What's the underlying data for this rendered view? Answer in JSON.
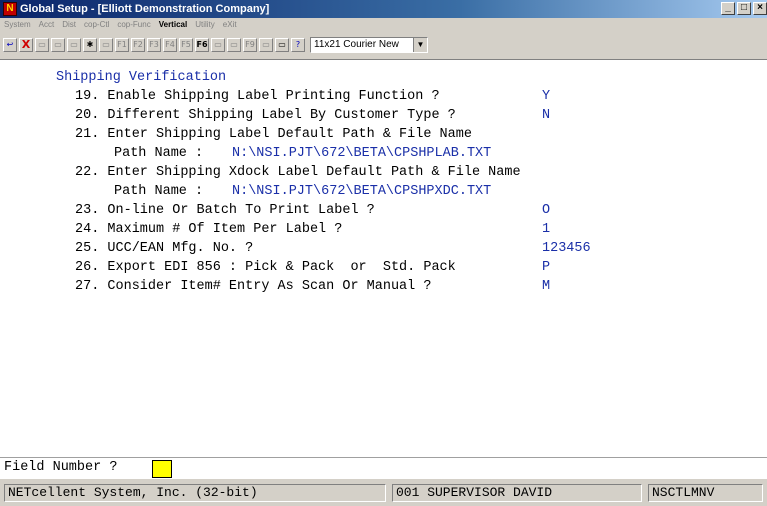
{
  "window": {
    "title": "Global Setup - [Elliott Demonstration Company]",
    "controls": [
      "_",
      "□",
      "×"
    ]
  },
  "menu": [
    "System",
    "Acct",
    "Dist",
    "cop-Ctl",
    "cop-Func",
    "Vertical",
    "Utility",
    "eXit"
  ],
  "toolbar": {
    "buttons": [
      "↩",
      "X",
      "▭",
      "▭",
      "▭",
      "✱",
      "▭",
      "F1",
      "F2",
      "F3",
      "F4",
      "F5",
      "F6",
      "▭",
      "▭",
      "F9",
      "▭",
      "▭",
      "?"
    ],
    "font_select": "11x21 Courier New"
  },
  "screen": {
    "heading": "Shipping Verification",
    "rows": [
      {
        "text": "19. Enable Shipping Label Printing Function ?",
        "value": "Y"
      },
      {
        "text": "20. Different Shipping Label By Customer Type ?",
        "value": "N"
      },
      {
        "text": "21. Enter Shipping Label Default Path & File Name",
        "value": ""
      },
      {
        "text": "Path Name :",
        "value": "N:\\NSI.PJT\\672\\BETA\\CPSHPLAB.TXT"
      },
      {
        "text": "22. Enter Shipping Xdock Label Default Path & File Name",
        "value": ""
      },
      {
        "text": "Path Name :",
        "value": "N:\\NSI.PJT\\672\\BETA\\CPSHPXDC.TXT"
      },
      {
        "text": "23. On-line Or Batch To Print Label ?",
        "value": "O"
      },
      {
        "text": "24. Maximum # Of Item Per Label ?",
        "value": "1"
      },
      {
        "text": "25. UCC/EAN Mfg. No. ?",
        "value": "123456"
      },
      {
        "text": "26. Export EDI 856 : Pick & Pack  or  Std. Pack",
        "value": "P"
      },
      {
        "text": "27. Consider Item# Entry As Scan Or Manual ?",
        "value": "M"
      }
    ]
  },
  "prompt": {
    "label": "Field Number ?",
    "value": ""
  },
  "status": {
    "company": "NETcellent System, Inc. (32-bit)",
    "user": "001 SUPERVISOR DAVID",
    "program": "NSCTLMNV"
  },
  "colors": {
    "value_text": "#1a2fa8",
    "input_field": "#ffff00",
    "title_bar": "#0a246a"
  }
}
